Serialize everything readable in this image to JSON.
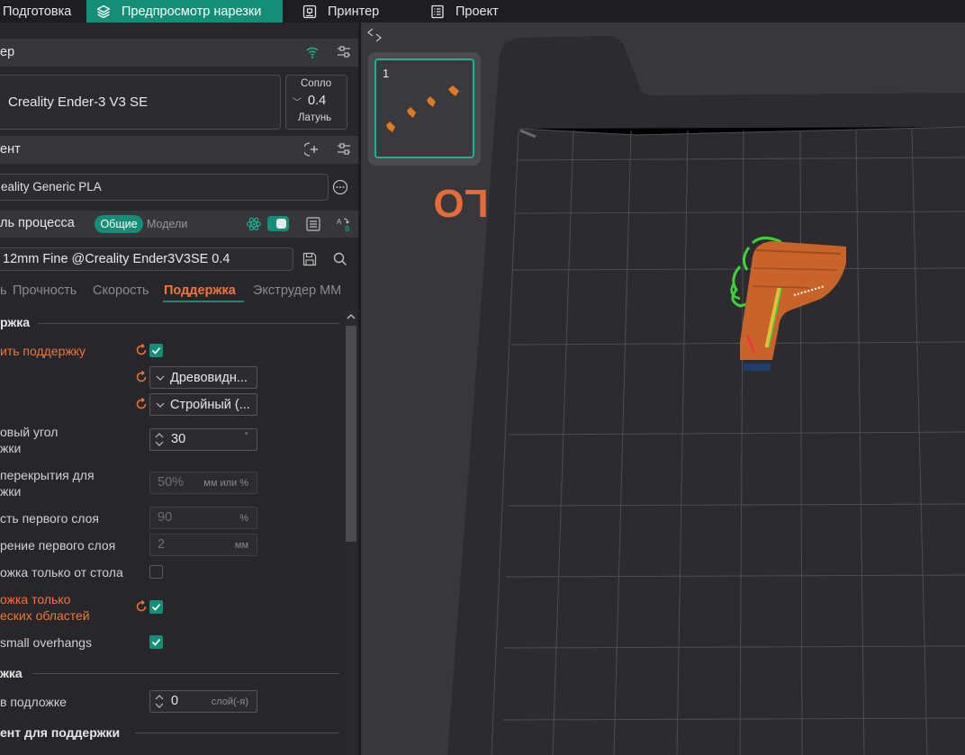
{
  "tabs": [
    {
      "label": "Подготовка",
      "active": false
    },
    {
      "label": "Предпросмотр нарезки",
      "active": true
    },
    {
      "label": "Принтер",
      "active": false
    },
    {
      "label": "Проект",
      "active": false
    }
  ],
  "printer": {
    "section_title": "ер",
    "name": "Creality Ender-3 V3 SE",
    "nozzle_label": "Сопло",
    "nozzle_value": "0.4",
    "nozzle_material": "Латунь"
  },
  "filament": {
    "section_title": "ент",
    "name": "eality Generic PLA"
  },
  "process": {
    "section_title": "ль процесса",
    "mode_general": "Общие",
    "mode_models": "Модели",
    "preset": "12mm Fine @Creality Ender3V3SE 0.4"
  },
  "subtabs": [
    {
      "label": "ь",
      "active": false
    },
    {
      "label": "Прочность",
      "active": false
    },
    {
      "label": "Скорость",
      "active": false
    },
    {
      "label": "Поддержка",
      "active": true
    },
    {
      "label": "Экструдер ММ",
      "active": false
    }
  ],
  "support_section": {
    "title": "ржка",
    "enable_label": "ить поддержку",
    "type_value": "Древовидн...",
    "style_value": "Стройный (...",
    "angle_label_1": "овый угол",
    "angle_label_2": "жки",
    "angle_value": "30",
    "angle_unit": "°",
    "overlap_label_1": "перекрытия для",
    "overlap_label_2": "жки",
    "overlap_value": "50%",
    "overlap_unit": "мм или %",
    "first_layer_density_label": "сть первого слоя",
    "first_layer_density_value": "90",
    "first_layer_density_unit": "%",
    "first_layer_expansion_label": "рение первого слоя",
    "first_layer_expansion_value": "2",
    "first_layer_expansion_unit": "мм",
    "on_build_plate_label": "ожка только от стола",
    "on_build_plate_checked": false,
    "critical_only_label_1": "ожка только",
    "critical_only_label_2": "еских областей",
    "critical_only_checked": true,
    "small_overhangs_label": "small overhangs",
    "small_overhangs_checked": true
  },
  "raft_section": {
    "title": "жка",
    "layers_label": "в подложке",
    "layers_value": "0",
    "layers_unit": "слой(-я)"
  },
  "filament_for_support_section": {
    "title": "ент для поддержки"
  },
  "viewport": {
    "plate_thumb_number": "1",
    "plate_label": "LO"
  },
  "colors": {
    "accent": "#148e76",
    "modified": "#f0763a",
    "model": "#c8642a",
    "support": "#3ed13a"
  }
}
